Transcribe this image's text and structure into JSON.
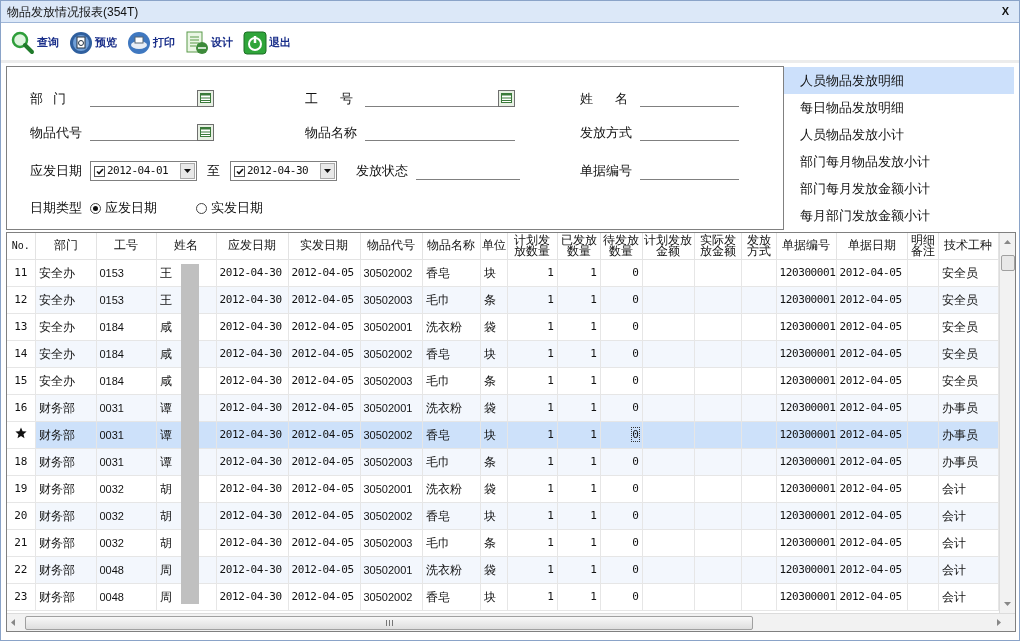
{
  "window": {
    "title": "物品发放情况报表(354T)",
    "close": "X"
  },
  "toolbar": [
    {
      "kind": "search",
      "label": "查询"
    },
    {
      "kind": "preview",
      "label": "预览"
    },
    {
      "kind": "print",
      "label": "打印"
    },
    {
      "kind": "design",
      "label": "设计"
    },
    {
      "kind": "exit",
      "label": "退出"
    }
  ],
  "filter_form": {
    "department": {
      "label": "部 门"
    },
    "employee_id": {
      "label": "工 号"
    },
    "name": {
      "label": "姓 名"
    },
    "item_code": {
      "label": "物品代号"
    },
    "item_name": {
      "label": "物品名称"
    },
    "issue_method": {
      "label": "发放方式"
    },
    "due_date": {
      "label": "应发日期",
      "from": {
        "value": "2012-04-01",
        "checked": true
      },
      "separator": "至",
      "to": {
        "value": "2012-04-30",
        "checked": true
      }
    },
    "issue_status": {
      "label": "发放状态"
    },
    "doc_no": {
      "label": "单据编号"
    },
    "date_type": {
      "label": "日期类型",
      "options": [
        {
          "label": "应发日期",
          "selected": true
        },
        {
          "label": "实发日期",
          "selected": false
        }
      ]
    }
  },
  "report_list": [
    {
      "label": "人员物品发放明细",
      "selected": true
    },
    {
      "label": "每日物品发放明细",
      "selected": false
    },
    {
      "label": "人员物品发放小计",
      "selected": false
    },
    {
      "label": "部门每月物品发放小计",
      "selected": false
    },
    {
      "label": "部门每月发放金额小计",
      "selected": false
    },
    {
      "label": "每月部门发放金额小计",
      "selected": false
    }
  ],
  "table": {
    "columns": [
      "No.",
      "部门",
      "工号",
      "姓名",
      "应发日期",
      "实发日期",
      "物品代号",
      "物品名称",
      "单位",
      "计划发放数量",
      "已发放数量",
      "待发放数量",
      "计划发放金额",
      "实际发放金额",
      "发放方式",
      "单据编号",
      "单据日期",
      "明细备注",
      "技术工种"
    ],
    "rows": [
      {
        "selected": false,
        "current": false,
        "cells": [
          "11",
          "安全办",
          "0153",
          "王",
          "2012-04-30",
          "2012-04-05",
          "30502002",
          "香皂",
          "块",
          "1",
          "1",
          "0",
          null,
          null,
          null,
          "120300001",
          "2012-04-05",
          null,
          "安全员"
        ]
      },
      {
        "selected": false,
        "current": false,
        "cells": [
          "12",
          "安全办",
          "0153",
          "王",
          "2012-04-30",
          "2012-04-05",
          "30502003",
          "毛巾",
          "条",
          "1",
          "1",
          "0",
          null,
          null,
          null,
          "120300001",
          "2012-04-05",
          null,
          "安全员"
        ]
      },
      {
        "selected": false,
        "current": false,
        "cells": [
          "13",
          "安全办",
          "0184",
          "咸",
          "2012-04-30",
          "2012-04-05",
          "30502001",
          "洗衣粉",
          "袋",
          "1",
          "1",
          "0",
          null,
          null,
          null,
          "120300001",
          "2012-04-05",
          null,
          "安全员"
        ]
      },
      {
        "selected": false,
        "current": false,
        "cells": [
          "14",
          "安全办",
          "0184",
          "咸",
          "2012-04-30",
          "2012-04-05",
          "30502002",
          "香皂",
          "块",
          "1",
          "1",
          "0",
          null,
          null,
          null,
          "120300001",
          "2012-04-05",
          null,
          "安全员"
        ]
      },
      {
        "selected": false,
        "current": false,
        "cells": [
          "15",
          "安全办",
          "0184",
          "咸",
          "2012-04-30",
          "2012-04-05",
          "30502003",
          "毛巾",
          "条",
          "1",
          "1",
          "0",
          null,
          null,
          null,
          "120300001",
          "2012-04-05",
          null,
          "安全员"
        ]
      },
      {
        "selected": false,
        "current": false,
        "cells": [
          "16",
          "财务部",
          "0031",
          "谭",
          "2012-04-30",
          "2012-04-05",
          "30502001",
          "洗衣粉",
          "袋",
          "1",
          "1",
          "0",
          null,
          null,
          null,
          "120300001",
          "2012-04-05",
          null,
          "办事员"
        ]
      },
      {
        "selected": true,
        "current": true,
        "cells": [
          null,
          "财务部",
          "0031",
          "谭",
          "2012-04-30",
          "2012-04-05",
          "30502002",
          "香皂",
          "块",
          "1",
          "1",
          {
            "text": "0",
            "focused": true
          },
          null,
          null,
          null,
          "120300001",
          "2012-04-05",
          null,
          "办事员"
        ]
      },
      {
        "selected": false,
        "current": false,
        "cells": [
          "18",
          "财务部",
          "0031",
          "谭",
          "2012-04-30",
          "2012-04-05",
          "30502003",
          "毛巾",
          "条",
          "1",
          "1",
          "0",
          null,
          null,
          null,
          "120300001",
          "2012-04-05",
          null,
          "办事员"
        ]
      },
      {
        "selected": false,
        "current": false,
        "cells": [
          "19",
          "财务部",
          "0032",
          "胡",
          "2012-04-30",
          "2012-04-05",
          "30502001",
          "洗衣粉",
          "袋",
          "1",
          "1",
          "0",
          null,
          null,
          null,
          "120300001",
          "2012-04-05",
          null,
          "会计"
        ]
      },
      {
        "selected": false,
        "current": false,
        "cells": [
          "20",
          "财务部",
          "0032",
          "胡",
          "2012-04-30",
          "2012-04-05",
          "30502002",
          "香皂",
          "块",
          "1",
          "1",
          "0",
          null,
          null,
          null,
          "120300001",
          "2012-04-05",
          null,
          "会计"
        ]
      },
      {
        "selected": false,
        "current": false,
        "cells": [
          "21",
          "财务部",
          "0032",
          "胡",
          "2012-04-30",
          "2012-04-05",
          "30502003",
          "毛巾",
          "条",
          "1",
          "1",
          "0",
          null,
          null,
          null,
          "120300001",
          "2012-04-05",
          null,
          "会计"
        ]
      },
      {
        "selected": false,
        "current": false,
        "cells": [
          "22",
          "财务部",
          "0048",
          "周",
          "2012-04-30",
          "2012-04-05",
          "30502001",
          "洗衣粉",
          "袋",
          "1",
          "1",
          "0",
          null,
          null,
          null,
          "120300001",
          "2012-04-05",
          null,
          "会计"
        ]
      },
      {
        "selected": false,
        "current": false,
        "cells": [
          "23",
          "财务部",
          "0048",
          "周",
          "2012-04-30",
          "2012-04-05",
          "30502002",
          "香皂",
          "块",
          "1",
          "1",
          "0",
          null,
          null,
          null,
          "120300001",
          "2012-04-05",
          null,
          "会计"
        ]
      }
    ]
  }
}
